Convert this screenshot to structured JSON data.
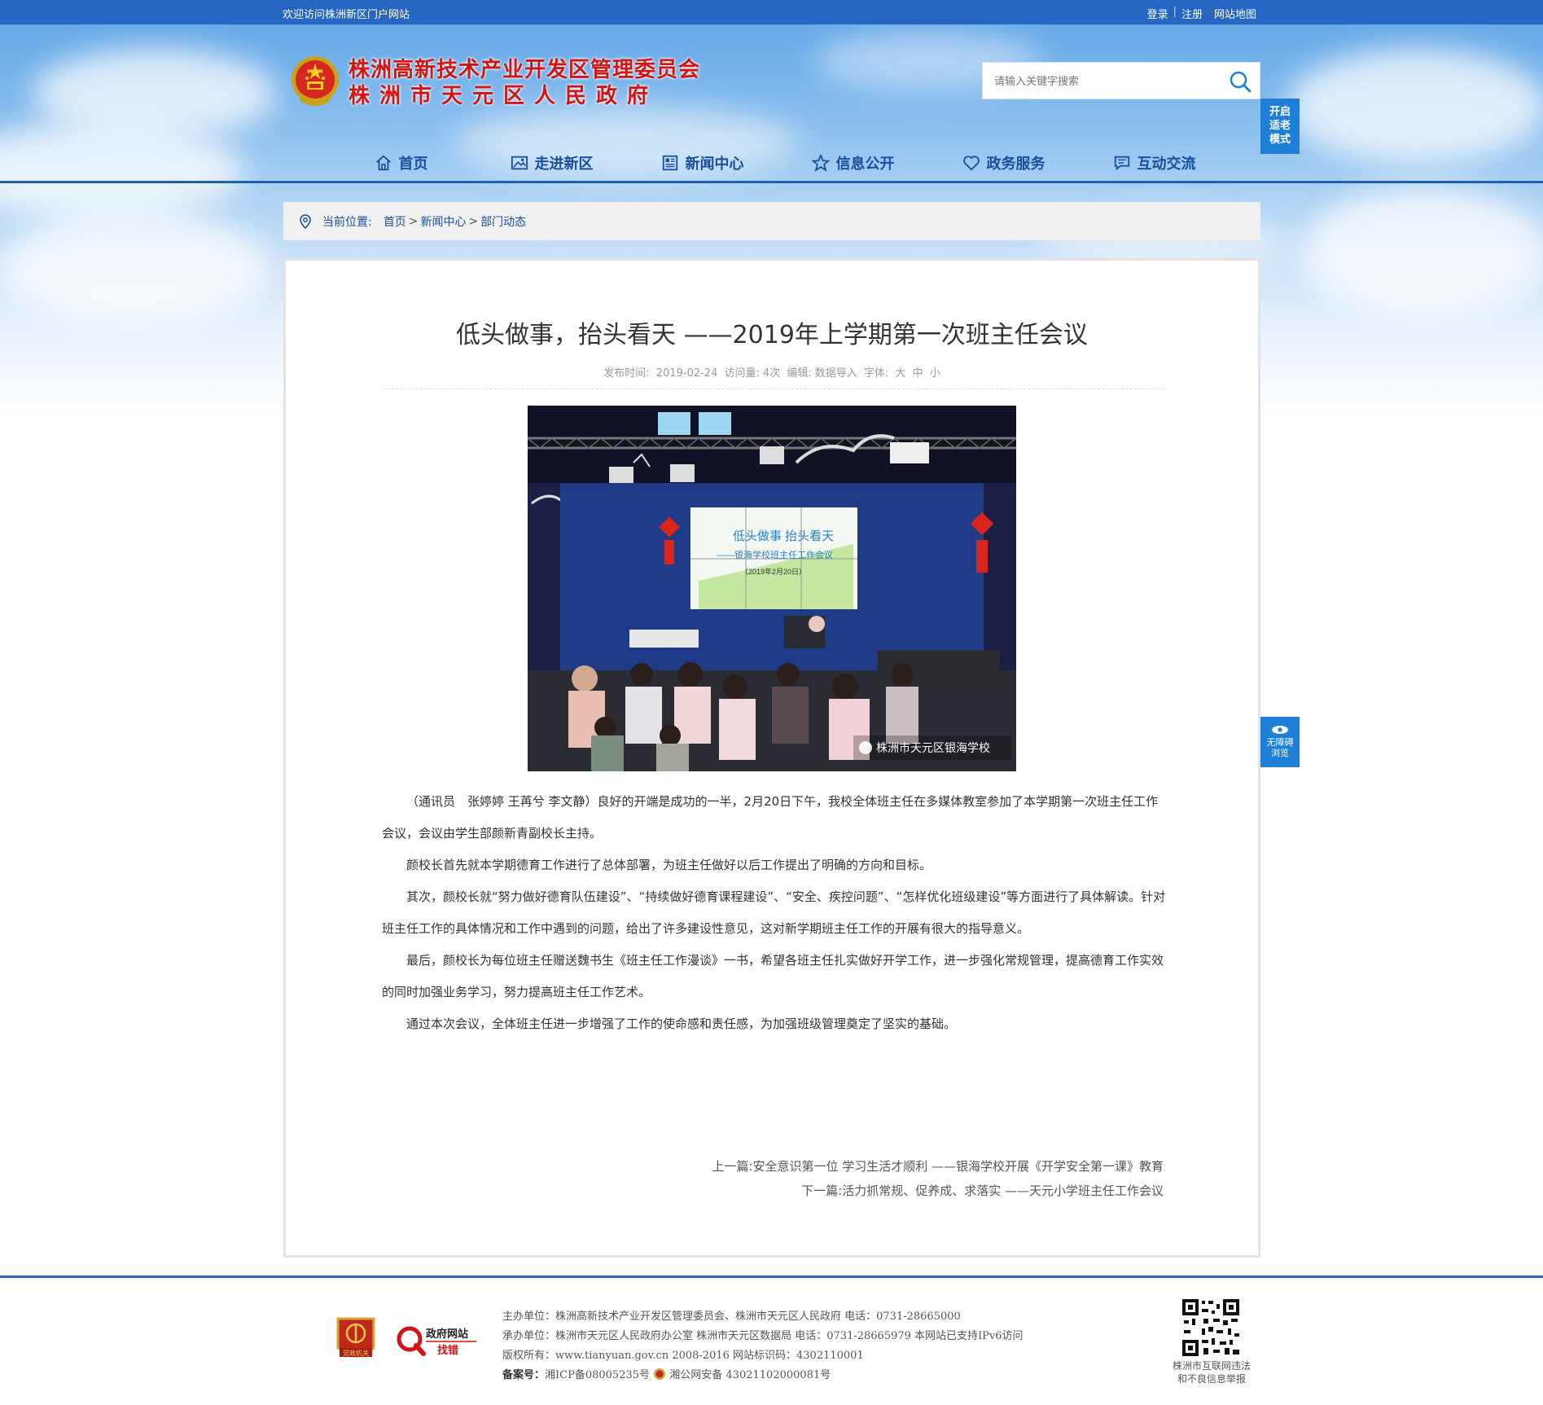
{
  "topbar": {
    "welcome": "欢迎访问株洲新区门户网站",
    "login": "登录",
    "separator": "|",
    "register": "注册",
    "sitemap": "网站地图"
  },
  "header": {
    "title_line1": "株洲高新技术产业开发区管理委员会",
    "title_line2": "株洲市天元区人民政府",
    "search_placeholder": "请输入关键字搜索",
    "elder_mode": [
      "开启",
      "适老",
      "模式"
    ]
  },
  "nav": {
    "items": [
      {
        "label": "首页",
        "icon": "home-icon"
      },
      {
        "label": "走进新区",
        "icon": "picture-icon"
      },
      {
        "label": "新闻中心",
        "icon": "newspaper-icon"
      },
      {
        "label": "信息公开",
        "icon": "star-icon"
      },
      {
        "label": "政务服务",
        "icon": "heart-icon"
      },
      {
        "label": "互动交流",
        "icon": "chat-icon"
      }
    ]
  },
  "breadcrumb": {
    "label": "当前位置:",
    "items": [
      "首页",
      "新闻中心",
      "部门动态"
    ],
    "sep": ">"
  },
  "article": {
    "title": "低头做事，抬头看天 ——2019年上学期第一次班主任会议",
    "meta_publish_label": "发布时间:",
    "meta_date": "2019-02-24",
    "meta_visits_label": "访问量:",
    "meta_visits": "4次",
    "meta_editor_label": "编辑:",
    "meta_editor": "数据导入",
    "meta_font_label": "字体:",
    "font_large": "大",
    "font_medium": "中",
    "font_small": "小",
    "photo": {
      "screen_line1": "低头做事  抬头看天",
      "screen_line2": "——银海学校班主任工作会议",
      "screen_line3": "（2019年2月20日）",
      "watermark": "株洲市天元区银海学校"
    },
    "paragraphs": [
      "（通讯员　张婷婷  王苒兮  李文静）良好的开端是成功的一半，2月20日下午，我校全体班主任在多媒体教室参加了本学期第一次班主任工作会议，会议由学生部颜新青副校长主持。",
      "颜校长首先就本学期德育工作进行了总体部署，为班主任做好以后工作提出了明确的方向和目标。",
      "其次，颜校长就“努力做好德育队伍建设”、“持续做好德育课程建设”、“安全、疾控问题”、“怎样优化班级建设”等方面进行了具体解读。针对班主任工作的具体情况和工作中遇到的问题，给出了许多建设性意见，这对新学期班主任工作的开展有很大的指导意义。",
      "最后，颜校长为每位班主任赠送魏书生《班主任工作漫谈》一书，希望各班主任扎实做好开学工作，进一步强化常规管理，提高德育工作实效的同时加强业务学习，努力提高班主任工作艺术。",
      "通过本次会议，全体班主任进一步增强了工作的使命感和责任感，为加强班级管理奠定了坚实的基础。"
    ],
    "prev_label": "上一篇:",
    "prev_title": "安全意识第一位 学习生活才顺利 ——银海学校开展《开学安全第一课》教育",
    "next_label": "下一篇:",
    "next_title": "活力抓常规、促养成、求落实 ——天元小学班主任工作会议"
  },
  "accessible": {
    "line1": "无障碍",
    "line2": "浏览"
  },
  "footer": {
    "badge_text": "党政机关",
    "jc_line1": "政府网站",
    "jc_line2": "找错",
    "host": "主办单位：株洲高新技术产业开发区管理委员会、株洲市天元区人民政府 电话：0731-28665000",
    "organizer": "承办单位：株洲市天元区人民政府办公室 株洲市天元区数据局 电话：0731-28665979 本网站已支持IPv6访问",
    "copyright": "版权所有：www.tianyuan.gov.cn 2008-2016 网站标识码：4302110001",
    "record_label": "备案号：",
    "record_icp": "湘ICP备08005235号",
    "record_police": "湘公网安备 43021102000081号",
    "qr_caption_line1": "株洲市互联网违法",
    "qr_caption_line2": "和不良信息举报"
  },
  "colors": {
    "topbar": "#2566c2",
    "nav_text": "#1a4fa0",
    "title_red": "#d01515",
    "float_blue": "#1f7fd8"
  }
}
